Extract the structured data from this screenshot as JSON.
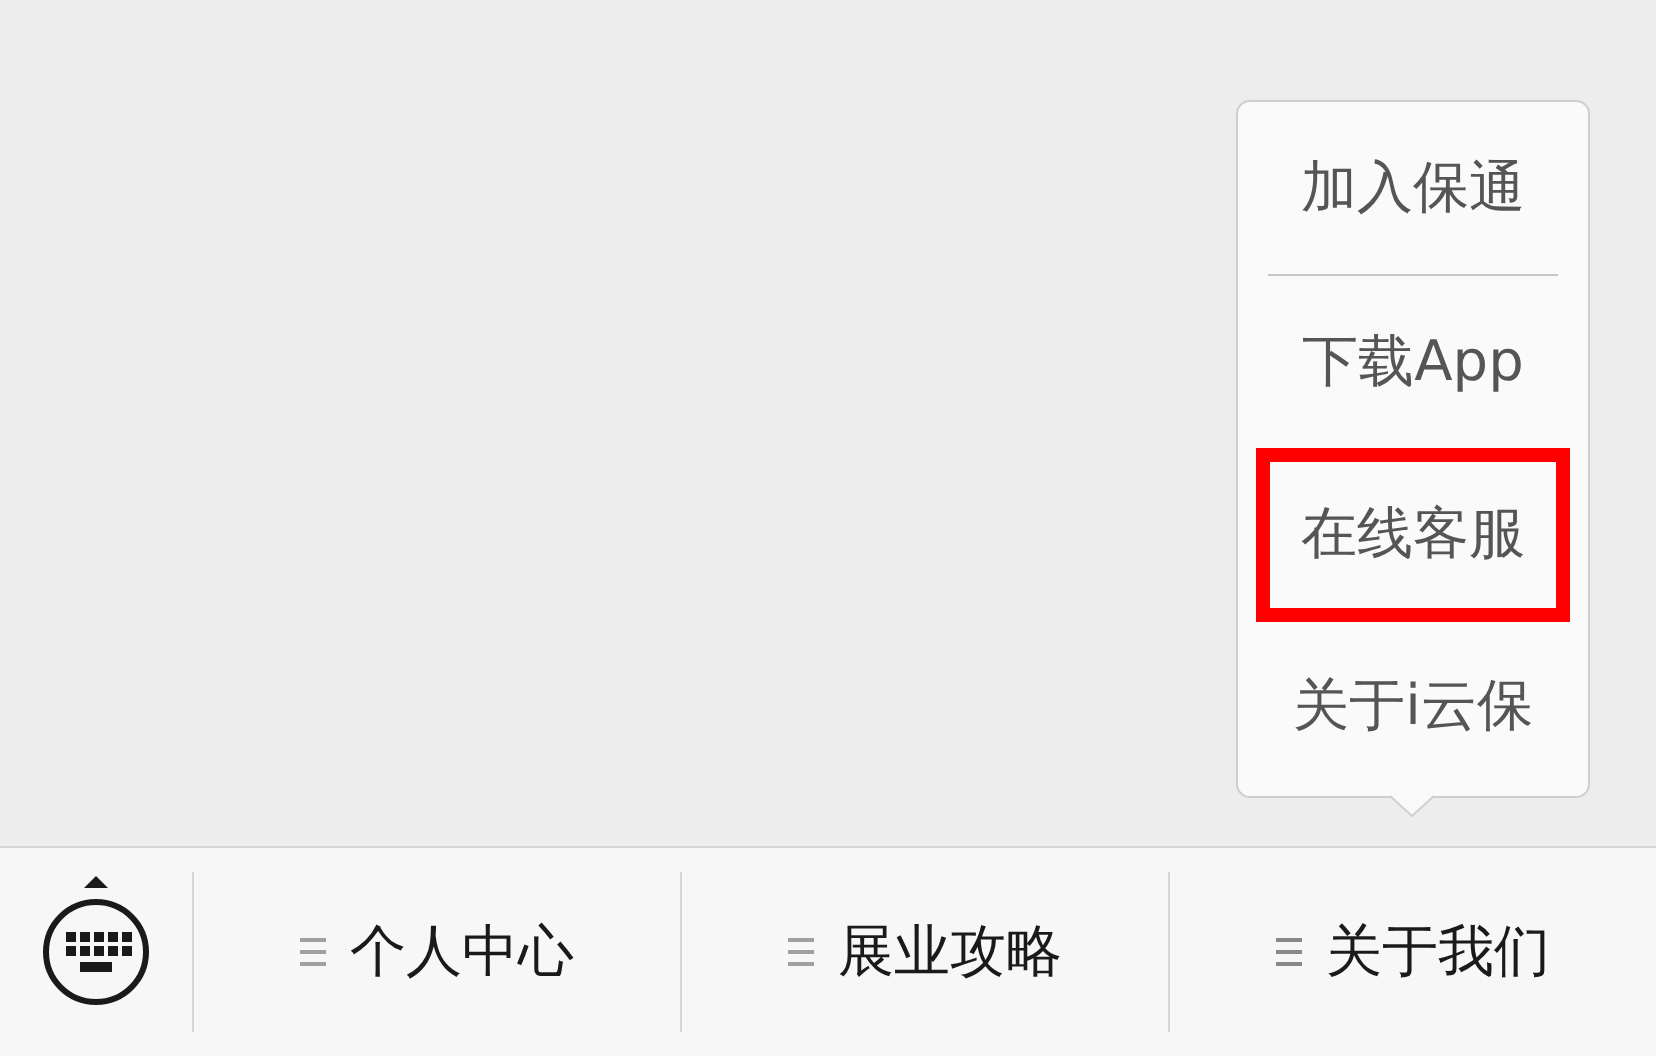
{
  "popup_menu": {
    "items": [
      {
        "label": "加入保通",
        "highlighted": false,
        "divider_below": true
      },
      {
        "label": "下载App",
        "highlighted": false,
        "divider_below": false
      },
      {
        "label": "在线客服",
        "highlighted": true,
        "divider_below": false
      },
      {
        "label": "关于i云保",
        "highlighted": false,
        "divider_below": false
      }
    ]
  },
  "bottom_bar": {
    "menus": [
      {
        "label": "个人中心",
        "expanded": false
      },
      {
        "label": "展业攻略",
        "expanded": false
      },
      {
        "label": "关于我们",
        "expanded": true
      }
    ]
  }
}
